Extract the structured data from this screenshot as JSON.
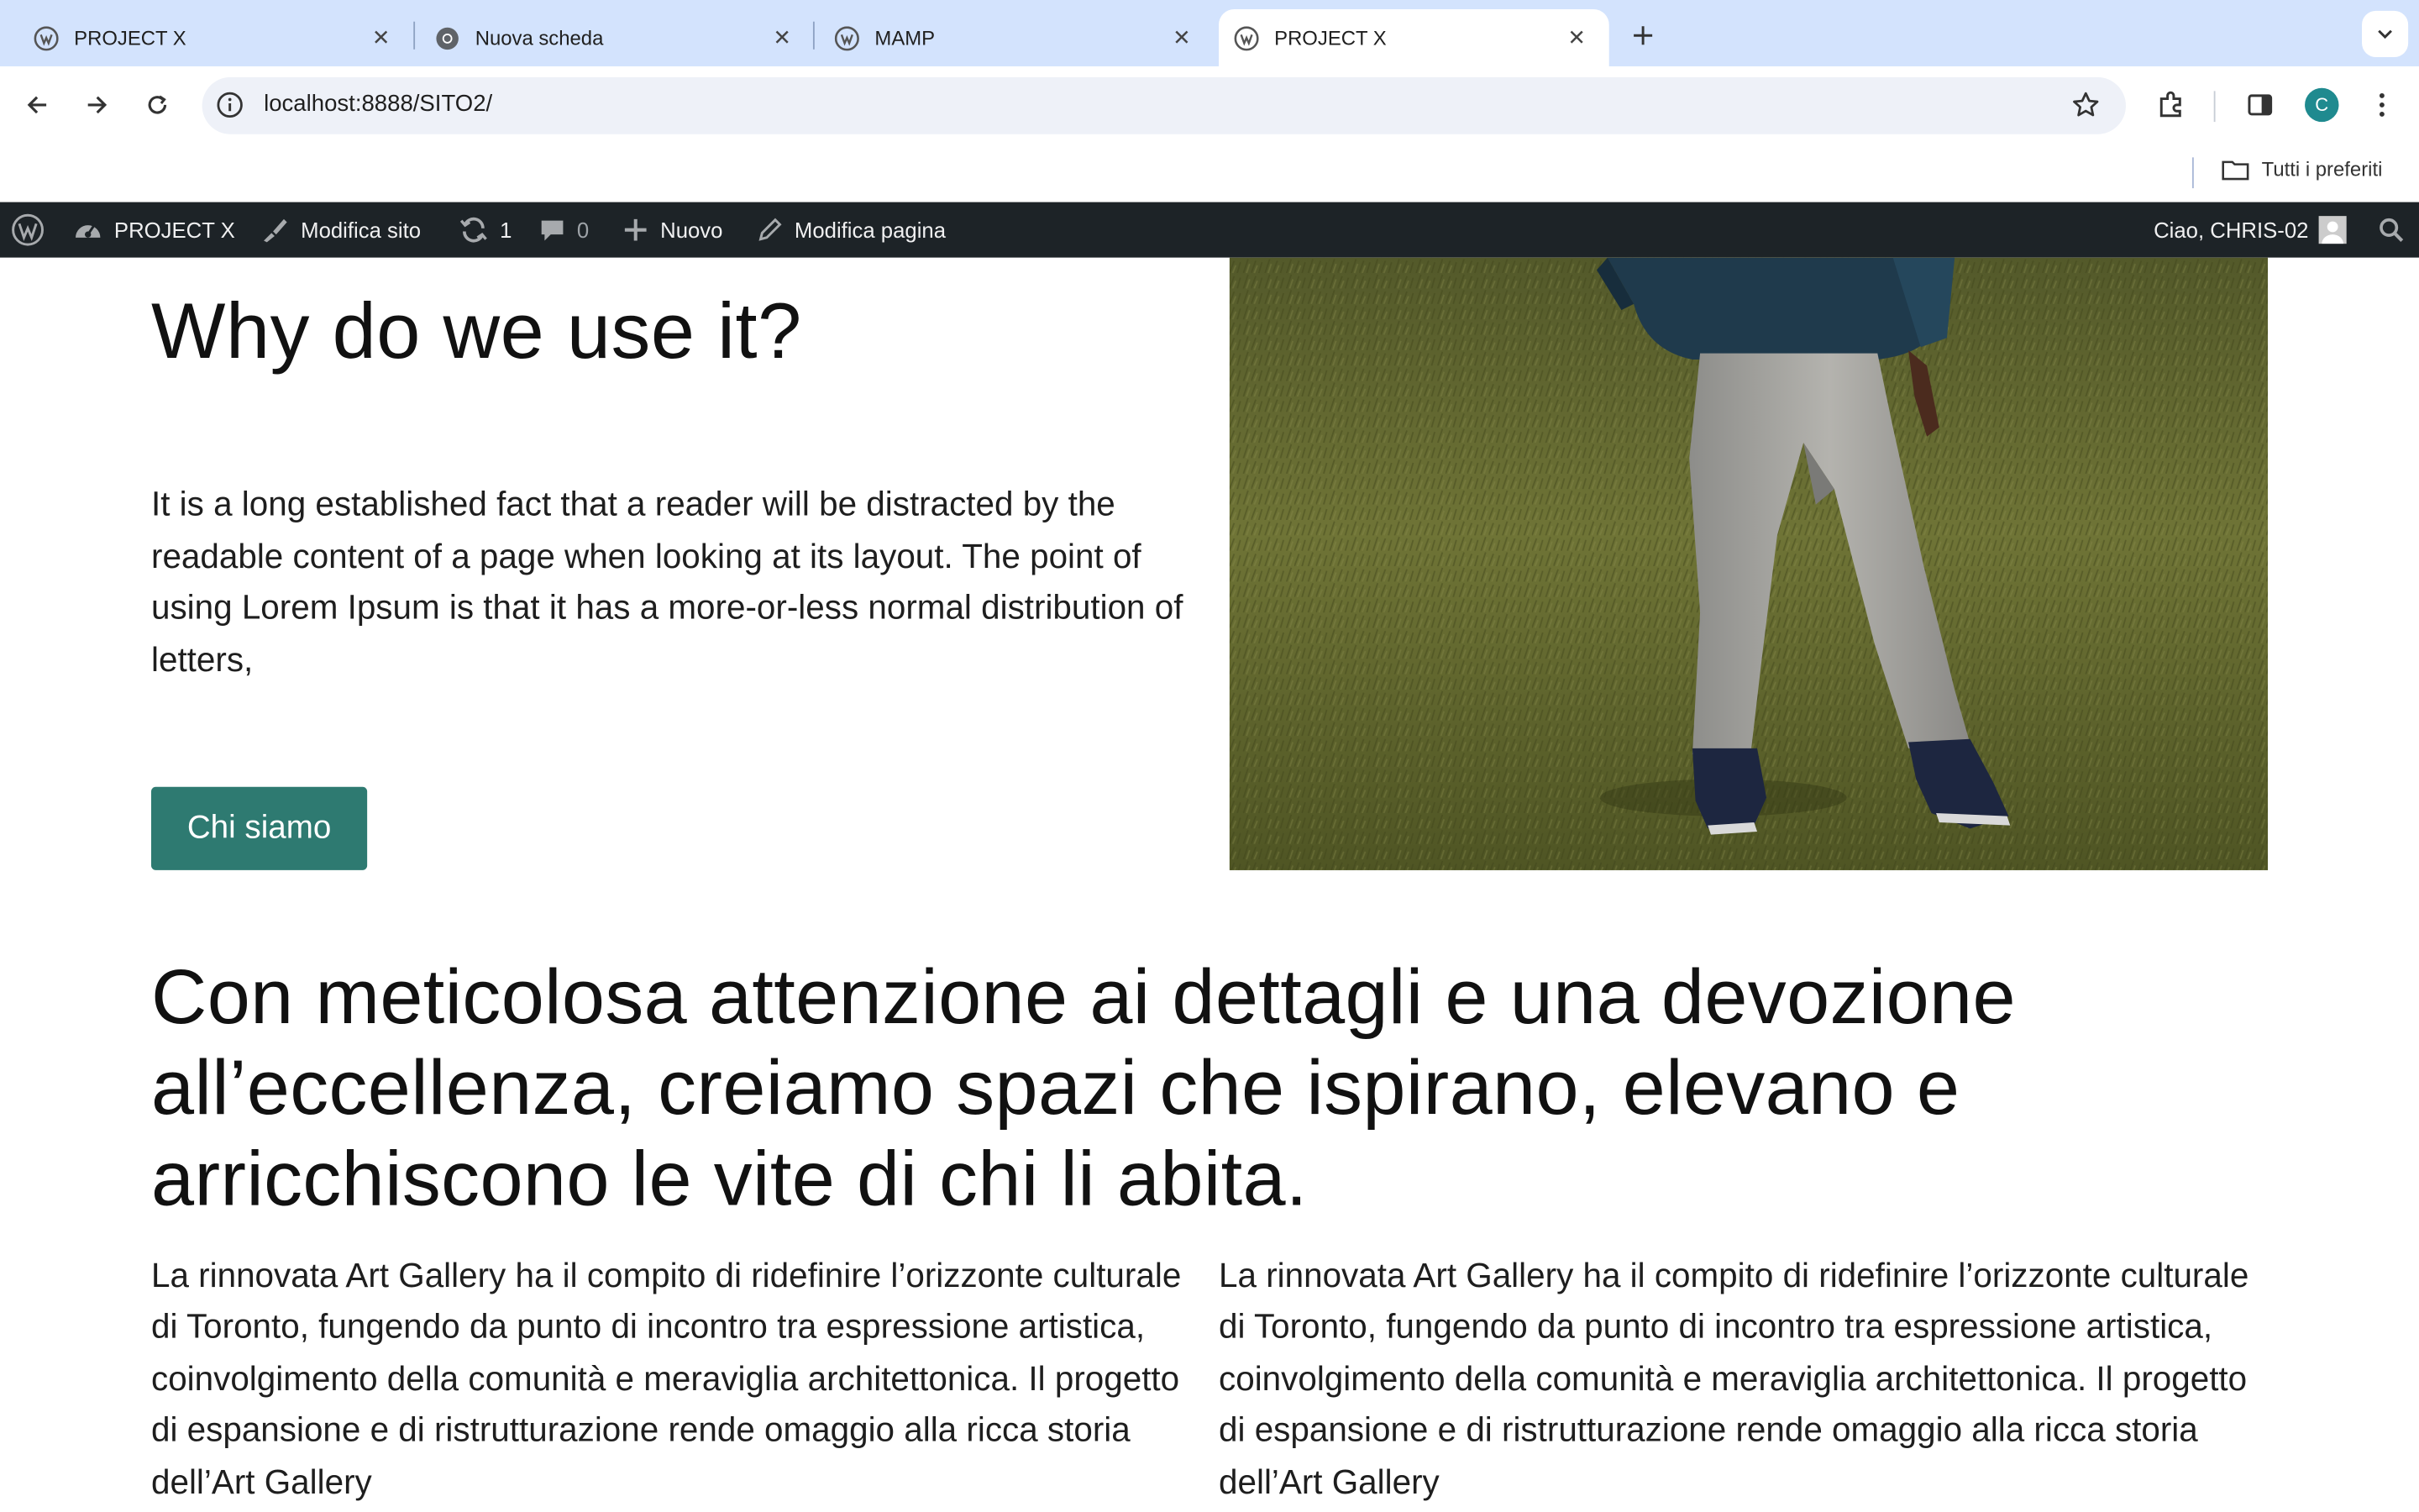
{
  "browser": {
    "tabs": [
      {
        "title": "PROJECT X",
        "favicon": "wordpress-icon",
        "active": false
      },
      {
        "title": "Nuova scheda",
        "favicon": "chrome-icon",
        "active": false
      },
      {
        "title": "MAMP",
        "favicon": "wordpress-icon",
        "active": false
      },
      {
        "title": "PROJECT X",
        "favicon": "wordpress-icon",
        "active": true
      }
    ],
    "address_bar": {
      "url": "localhost:8888/SITO2/"
    },
    "profile_initial": "C",
    "bookmarks": {
      "all_bookmarks_label": "Tutti i preferiti"
    }
  },
  "admin_bar": {
    "site_name": "PROJECT X",
    "edit_site": "Modifica sito",
    "updates_count": "1",
    "comments_count": "0",
    "new_label": "Nuovo",
    "edit_page": "Modifica pagina",
    "greeting": "Ciao, CHRIS-02"
  },
  "page": {
    "hero": {
      "title": "Why do we use it?",
      "body": "It is a long established fact that a reader will be distracted by the readable content of a page when looking at its layout. The point of using Lorem Ipsum is that it has a more-or-less normal distribution of letters,",
      "button_label": "Chi siamo"
    },
    "statement": "Con meticolosa attenzione ai dettagli e una devozione all’eccellenza, creiamo spazi che ispirano, elevano e arricchiscono le vite di chi li abita.",
    "columns": [
      {
        "text": "La rinnovata Art Gallery ha il compito di ridefinire l’orizzonte culturale di Toronto, fungendo da punto di incontro tra espressione artistica, coinvolgimento della comunità e meraviglia architettonica. Il progetto di espansione e di ristrutturazione rende omaggio alla ricca storia dell’Art Gallery"
      },
      {
        "text": "La rinnovata Art Gallery ha il compito di ridefinire l’orizzonte culturale di Toronto, fungendo da punto di incontro tra espressione artistica, coinvolgimento della comunità e meraviglia architettonica. Il progetto di espansione e di ristrutturazione rende omaggio alla ricca storia dell’Art Gallery"
      }
    ]
  },
  "colors": {
    "tabstrip_bg": "#d3e3fd",
    "admin_bar_bg": "#1d2327",
    "button_bg": "#2e7a71",
    "profile_avatar": "#1f8a8f"
  }
}
